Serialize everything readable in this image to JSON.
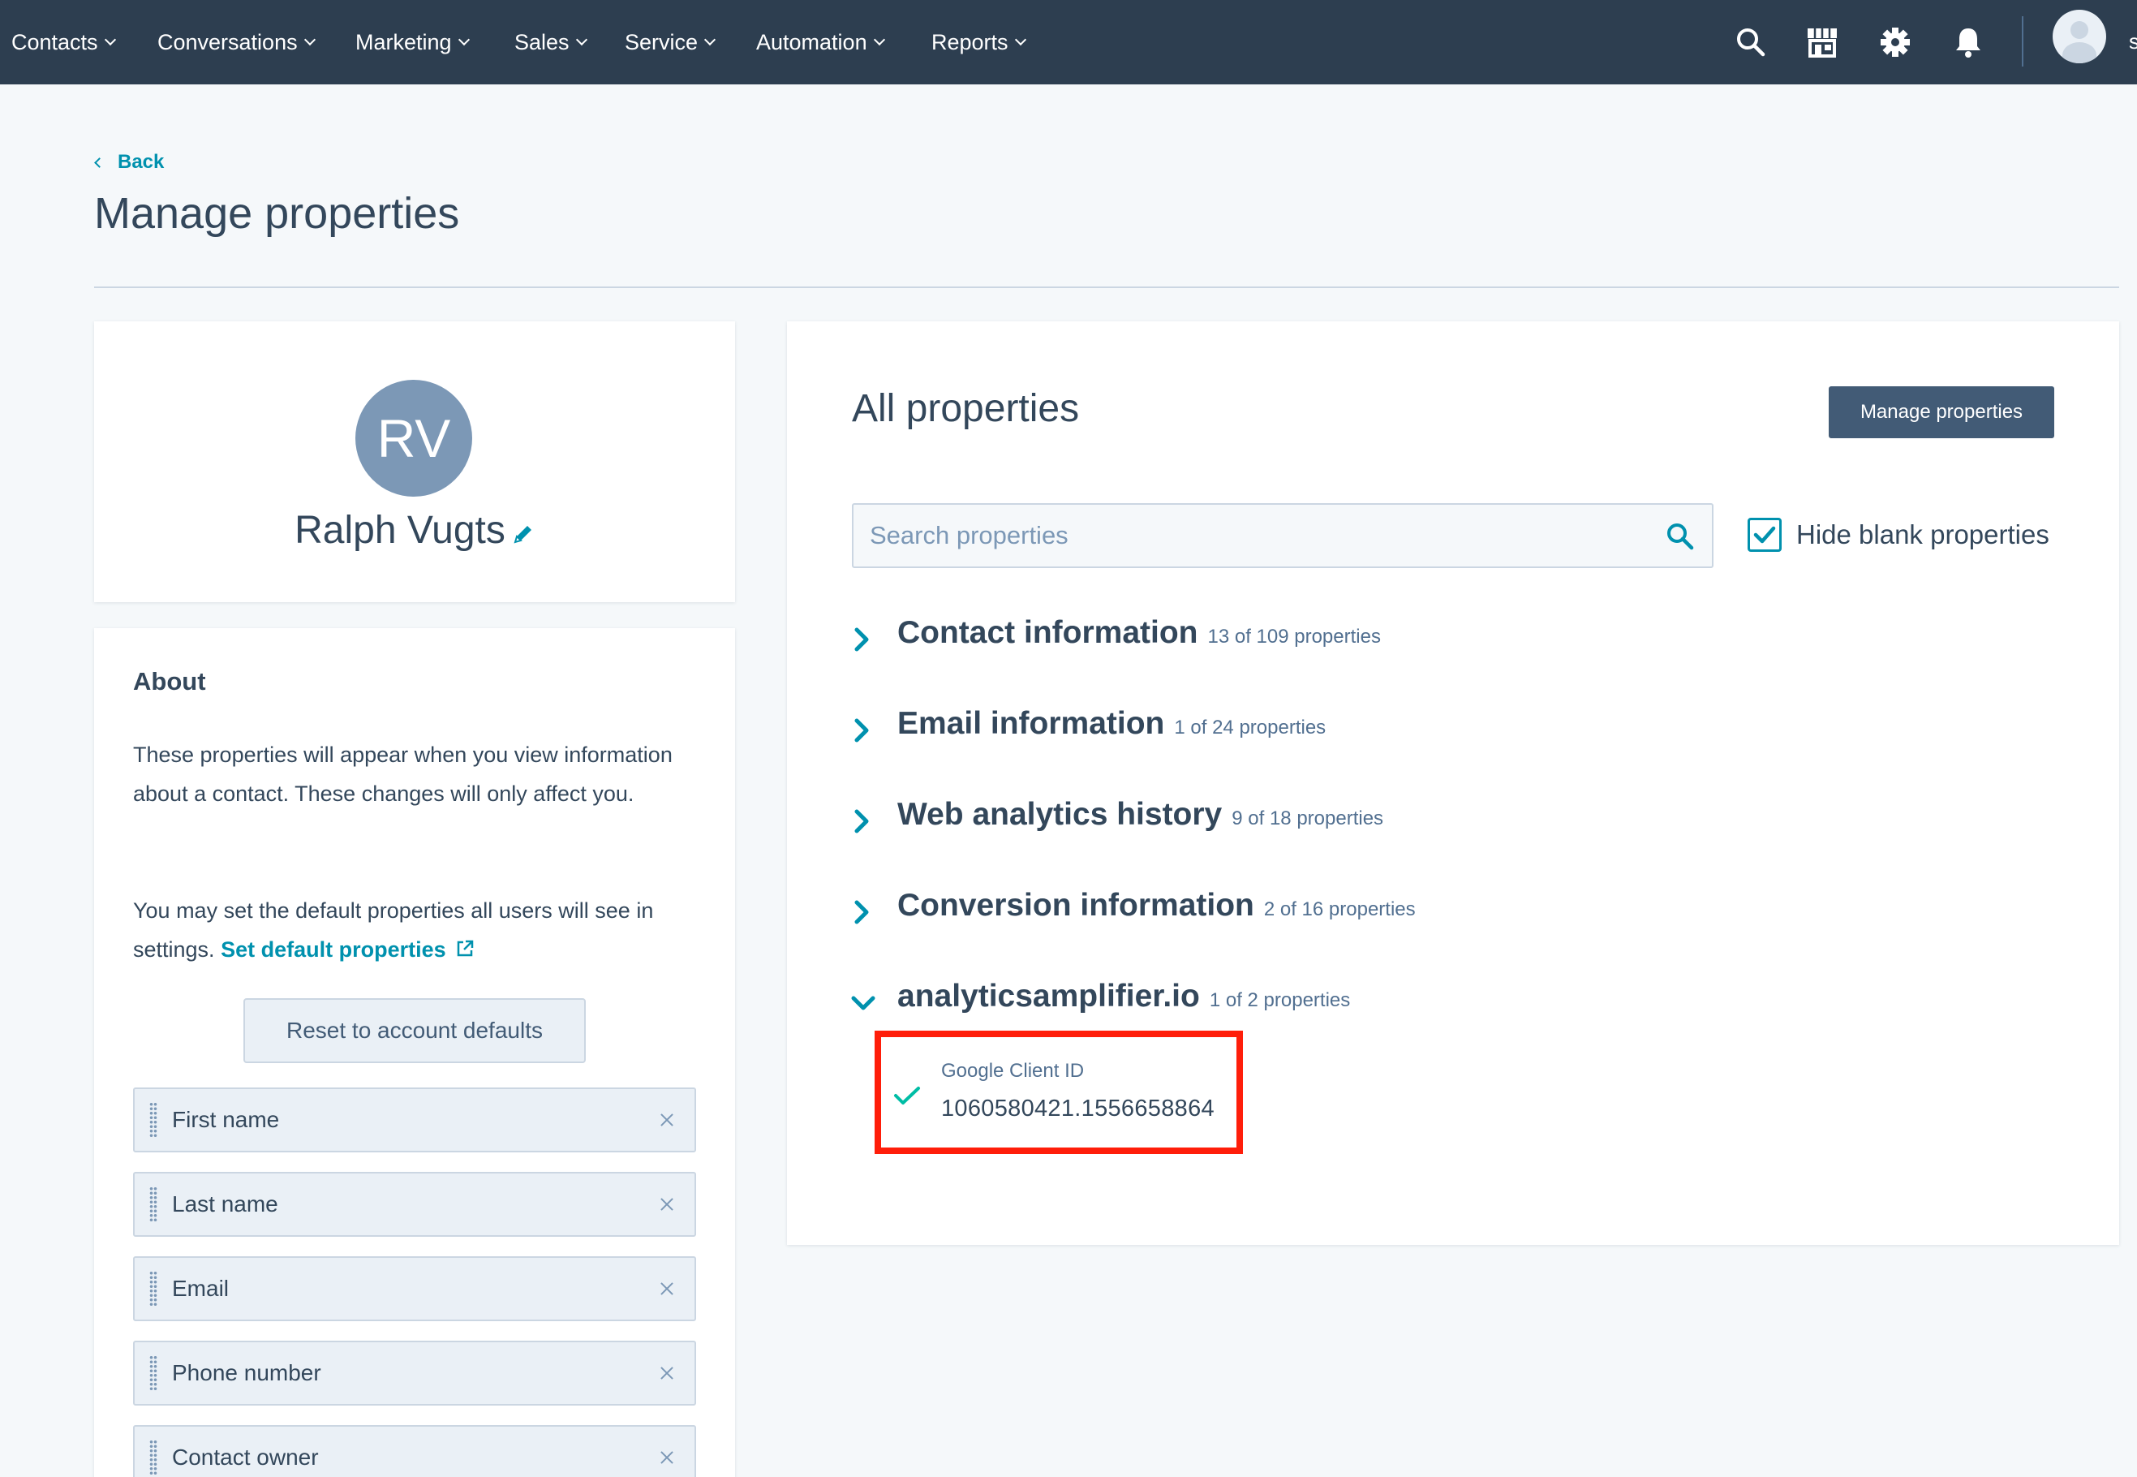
{
  "nav": {
    "items": [
      "Contacts",
      "Conversations",
      "Marketing",
      "Sales",
      "Service",
      "Automation",
      "Reports"
    ],
    "icons": [
      "search-icon",
      "marketplace-icon",
      "gear-icon",
      "bell-icon"
    ],
    "truncated_text": "s",
    "background": "#2d3e50"
  },
  "header": {
    "back_label": "Back",
    "title": "Manage properties"
  },
  "profile": {
    "initials": "RV",
    "name": "Ralph Vugts"
  },
  "about": {
    "title": "About",
    "paragraph1": "These properties will appear when you view information about a contact. These changes will only affect you.",
    "paragraph2_prefix": "You may set the default properties all users will see in settings.",
    "paragraph2_link": "Set default properties",
    "reset_label": "Reset to account defaults",
    "properties": [
      "First name",
      "Last name",
      "Email",
      "Phone number",
      "Contact owner"
    ]
  },
  "all_properties": {
    "title": "All properties",
    "manage_label": "Manage properties",
    "search_placeholder": "Search properties",
    "hide_blank_label": "Hide blank properties",
    "hide_blank_checked": true,
    "sections": [
      {
        "name": "Contact information",
        "count": "13 of 109 properties",
        "expanded": false
      },
      {
        "name": "Email information",
        "count": "1 of 24 properties",
        "expanded": false
      },
      {
        "name": "Web analytics history",
        "count": "9 of 18 properties",
        "expanded": false
      },
      {
        "name": "Conversion information",
        "count": "2 of 16 properties",
        "expanded": false
      },
      {
        "name": "analyticsamplifier.io",
        "count": "1 of 2 properties",
        "expanded": true
      }
    ],
    "expanded_property": {
      "label": "Google Client ID",
      "value": "1060580421.1556658864"
    }
  },
  "colors": {
    "accent": "#0091ae",
    "check": "#00bda5",
    "highlight": "#ff1e0a",
    "avatar": "#7c98b6"
  }
}
